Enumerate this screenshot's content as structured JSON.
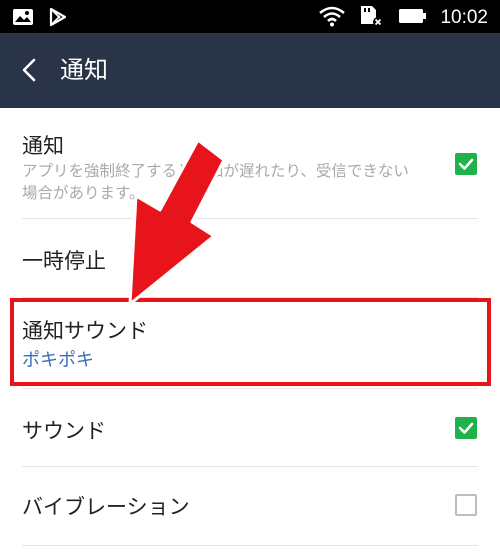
{
  "status_bar": {
    "time": "10:02",
    "icons": [
      "image-icon",
      "play-store-icon",
      "wifi-icon",
      "sd-card-icon",
      "battery-icon"
    ]
  },
  "app_bar": {
    "title": "通知",
    "back_icon": "chevron-left-icon"
  },
  "settings": {
    "notifications": {
      "title": "通知",
      "description": "アプリを強制終了すると通知が遅れたり、受信できない場合があります。",
      "checked": true
    },
    "pause": {
      "title": "一時停止"
    },
    "notification_sound": {
      "title": "通知サウンド",
      "value": "ポキポキ"
    },
    "sound": {
      "title": "サウンド",
      "checked": true
    },
    "vibration": {
      "title": "バイブレーション",
      "checked": false
    }
  },
  "colors": {
    "app_bar": "#293448",
    "checkbox_on": "#1fb14a",
    "accent_text": "#3a6eb8",
    "annotation": "#e8141b"
  }
}
